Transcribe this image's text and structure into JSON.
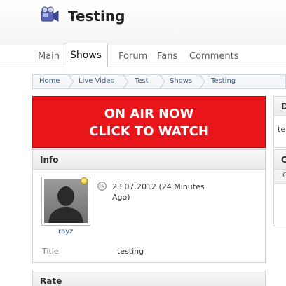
{
  "header": {
    "title": "Testing",
    "logo_icon": "video-camera-icon"
  },
  "tabs": [
    {
      "label": "Main",
      "active": false
    },
    {
      "label": "Shows",
      "active": true
    },
    {
      "label": "Forum",
      "active": false
    },
    {
      "label": "Fans",
      "active": false
    },
    {
      "label": "Comments",
      "active": false
    }
  ],
  "breadcrumb": [
    "Home",
    "Live Video",
    "Test",
    "Shows",
    "Testing"
  ],
  "onair": {
    "line1": "ON AIR NOW",
    "line2": "CLICK TO WATCH",
    "color": "#e8151b"
  },
  "info": {
    "heading": "Info",
    "username": "rayz",
    "status_icon": "online-status-icon",
    "datetime_line1": "23.07.2012 (24 Minutes",
    "datetime_line2": "Ago)",
    "title_label": "Title",
    "title_value": "testing"
  },
  "rate": {
    "heading": "Rate"
  },
  "right_panels": {
    "panel1_heading": "D",
    "panel1_text": "te",
    "panel2_heading": "C",
    "panel2_row": "C"
  }
}
